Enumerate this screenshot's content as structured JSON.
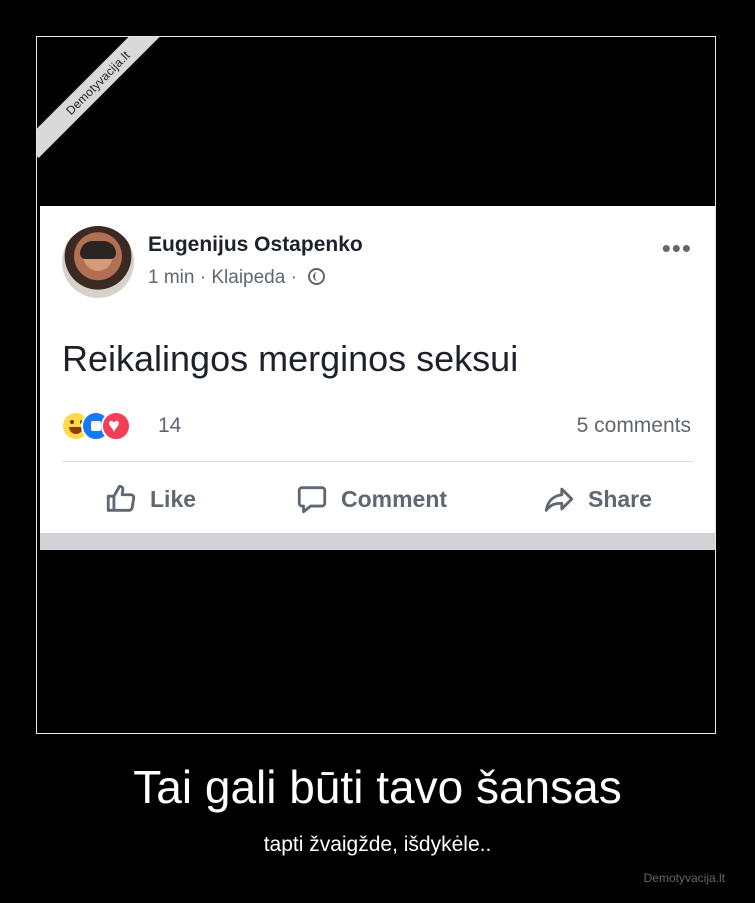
{
  "watermark": "Demotyvacija.lt",
  "post": {
    "author": "Eugenijus Ostapenko",
    "time": "1 min",
    "location": "Klaipeda",
    "separator": "·",
    "more": "•••",
    "text": "Reikalingos merginos seksui",
    "reaction_count": "14",
    "comments": "5 comments",
    "reactions": [
      "haha",
      "like",
      "love"
    ]
  },
  "actions": {
    "like": "Like",
    "comment": "Comment",
    "share": "Share"
  },
  "caption": "Tai gali būti tavo šansas",
  "subcaption": "tapti žvaigžde, išdykėle..",
  "site": "Demotyvacija.lt"
}
